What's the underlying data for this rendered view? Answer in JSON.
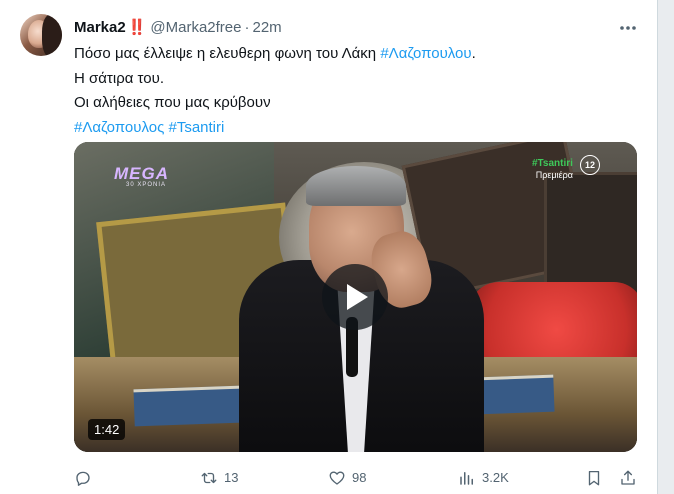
{
  "tweet": {
    "display_name": "Marka2",
    "badge": "‼️",
    "handle": "@Marka2free",
    "separator": "·",
    "time": "22m",
    "text_line1": "Πόσο μας έλλειψε η ελευθερη φωνη του Λάκη",
    "text_line1_hashtag": "#Λαζοπουλου",
    "text_line1_end": ".",
    "text_line2": "Η σάτιρα του.",
    "text_line3": "Οι αλήθειες που μας κρύβουν",
    "hashtag_1": "#Λαζοπουλος",
    "hashtag_2": "#Tsantiri"
  },
  "media": {
    "type": "video",
    "duration": "1:42",
    "channel_logo": "MEGA",
    "channel_logo_sub": "30 ΧΡΟΝΙΑ",
    "show_tag": "#Tsantiri",
    "show_sub": "Πρεμιέρα",
    "age_rating": "12"
  },
  "actions": {
    "reply_count": "",
    "retweet_count": "13",
    "like_count": "98",
    "views_count": "3.2K"
  },
  "icons": {
    "more": "more-dots-icon",
    "reply": "reply-icon",
    "retweet": "retweet-icon",
    "like": "heart-icon",
    "views": "views-icon",
    "bookmark": "bookmark-icon",
    "share": "share-icon",
    "play": "play-icon"
  },
  "colors": {
    "link": "#1d9bf0",
    "muted": "#536471",
    "text": "#0f1419",
    "badge": "#e0245e"
  }
}
